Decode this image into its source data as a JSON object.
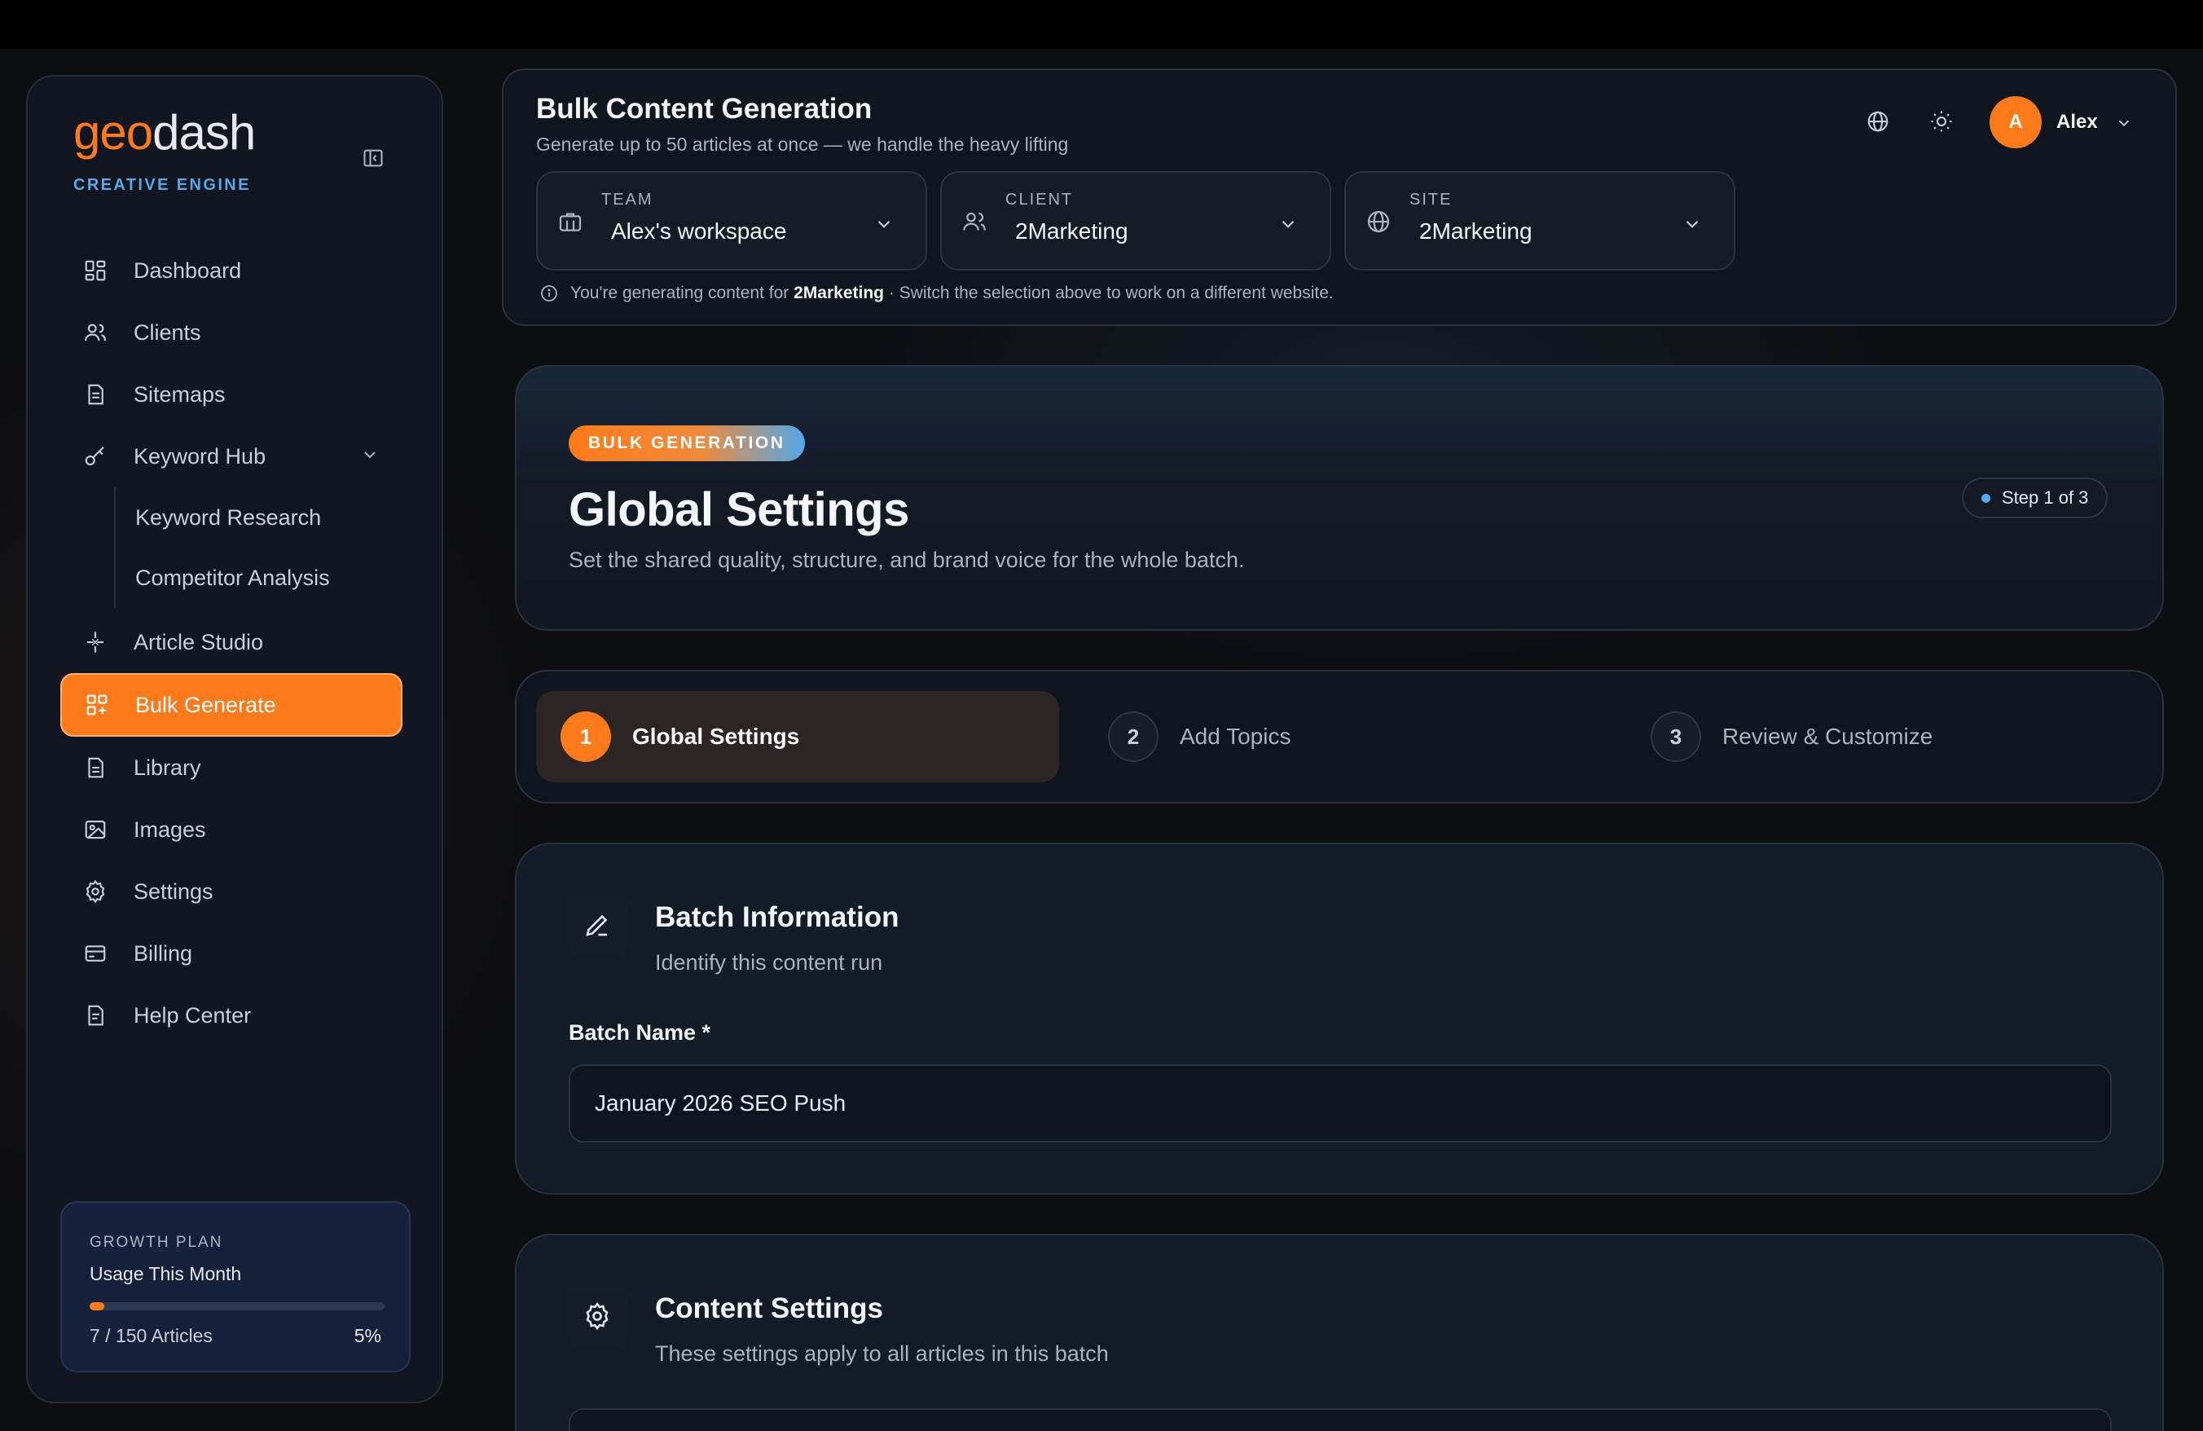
{
  "brand": {
    "logo_part1": "geo",
    "logo_part2": "dash",
    "tagline": "CREATIVE ENGINE",
    "accent": "#ff7a1a",
    "secondary": "#52a8e8"
  },
  "sidebar": {
    "items": [
      {
        "label": "Dashboard",
        "icon": "dashboard-icon"
      },
      {
        "label": "Clients",
        "icon": "users-icon"
      },
      {
        "label": "Sitemaps",
        "icon": "document-icon"
      },
      {
        "label": "Keyword Hub",
        "icon": "key-icon"
      },
      {
        "label": "Article Studio",
        "icon": "sparkle-icon"
      },
      {
        "label": "Bulk Generate",
        "icon": "grid-plus-icon"
      },
      {
        "label": "Library",
        "icon": "file-icon"
      },
      {
        "label": "Images",
        "icon": "image-icon"
      },
      {
        "label": "Settings",
        "icon": "gear-icon"
      },
      {
        "label": "Billing",
        "icon": "credit-card-icon"
      },
      {
        "label": "Help Center",
        "icon": "help-doc-icon"
      }
    ],
    "keyword_hub_children": [
      "Keyword Research",
      "Competitor Analysis"
    ],
    "active": "Bulk Generate"
  },
  "usage": {
    "plan": "GROWTH PLAN",
    "title": "Usage This Month",
    "count": "7 / 150 Articles",
    "percent_label": "5%",
    "percent": 5
  },
  "header": {
    "title": "Bulk Content Generation",
    "subtitle": "Generate up to 50 articles at once — we handle the heavy lifting",
    "user_initial": "A",
    "user_name": "Alex",
    "selectors": [
      {
        "label": "TEAM",
        "value": "Alex's workspace"
      },
      {
        "label": "CLIENT",
        "value": "2Marketing"
      },
      {
        "label": "SITE",
        "value": "2Marketing"
      }
    ],
    "info_prefix": "You're generating content for",
    "info_site": "2Marketing",
    "info_suffix": "· Switch the selection above to work on a different website."
  },
  "hero": {
    "pill": "BULK GENERATION",
    "title": "Global Settings",
    "subtitle": "Set the shared quality, structure, and brand voice for the whole batch.",
    "step_badge": "Step 1 of 3"
  },
  "stepper": {
    "steps": [
      {
        "num": "1",
        "label": "Global Settings"
      },
      {
        "num": "2",
        "label": "Add Topics"
      },
      {
        "num": "3",
        "label": "Review & Customize"
      }
    ]
  },
  "batch": {
    "title": "Batch Information",
    "subtitle": "Identify this content run",
    "field_label": "Batch Name *",
    "field_value": "January 2026 SEO Push"
  },
  "content_settings": {
    "title": "Content Settings",
    "subtitle": "These settings apply to all articles in this batch"
  }
}
